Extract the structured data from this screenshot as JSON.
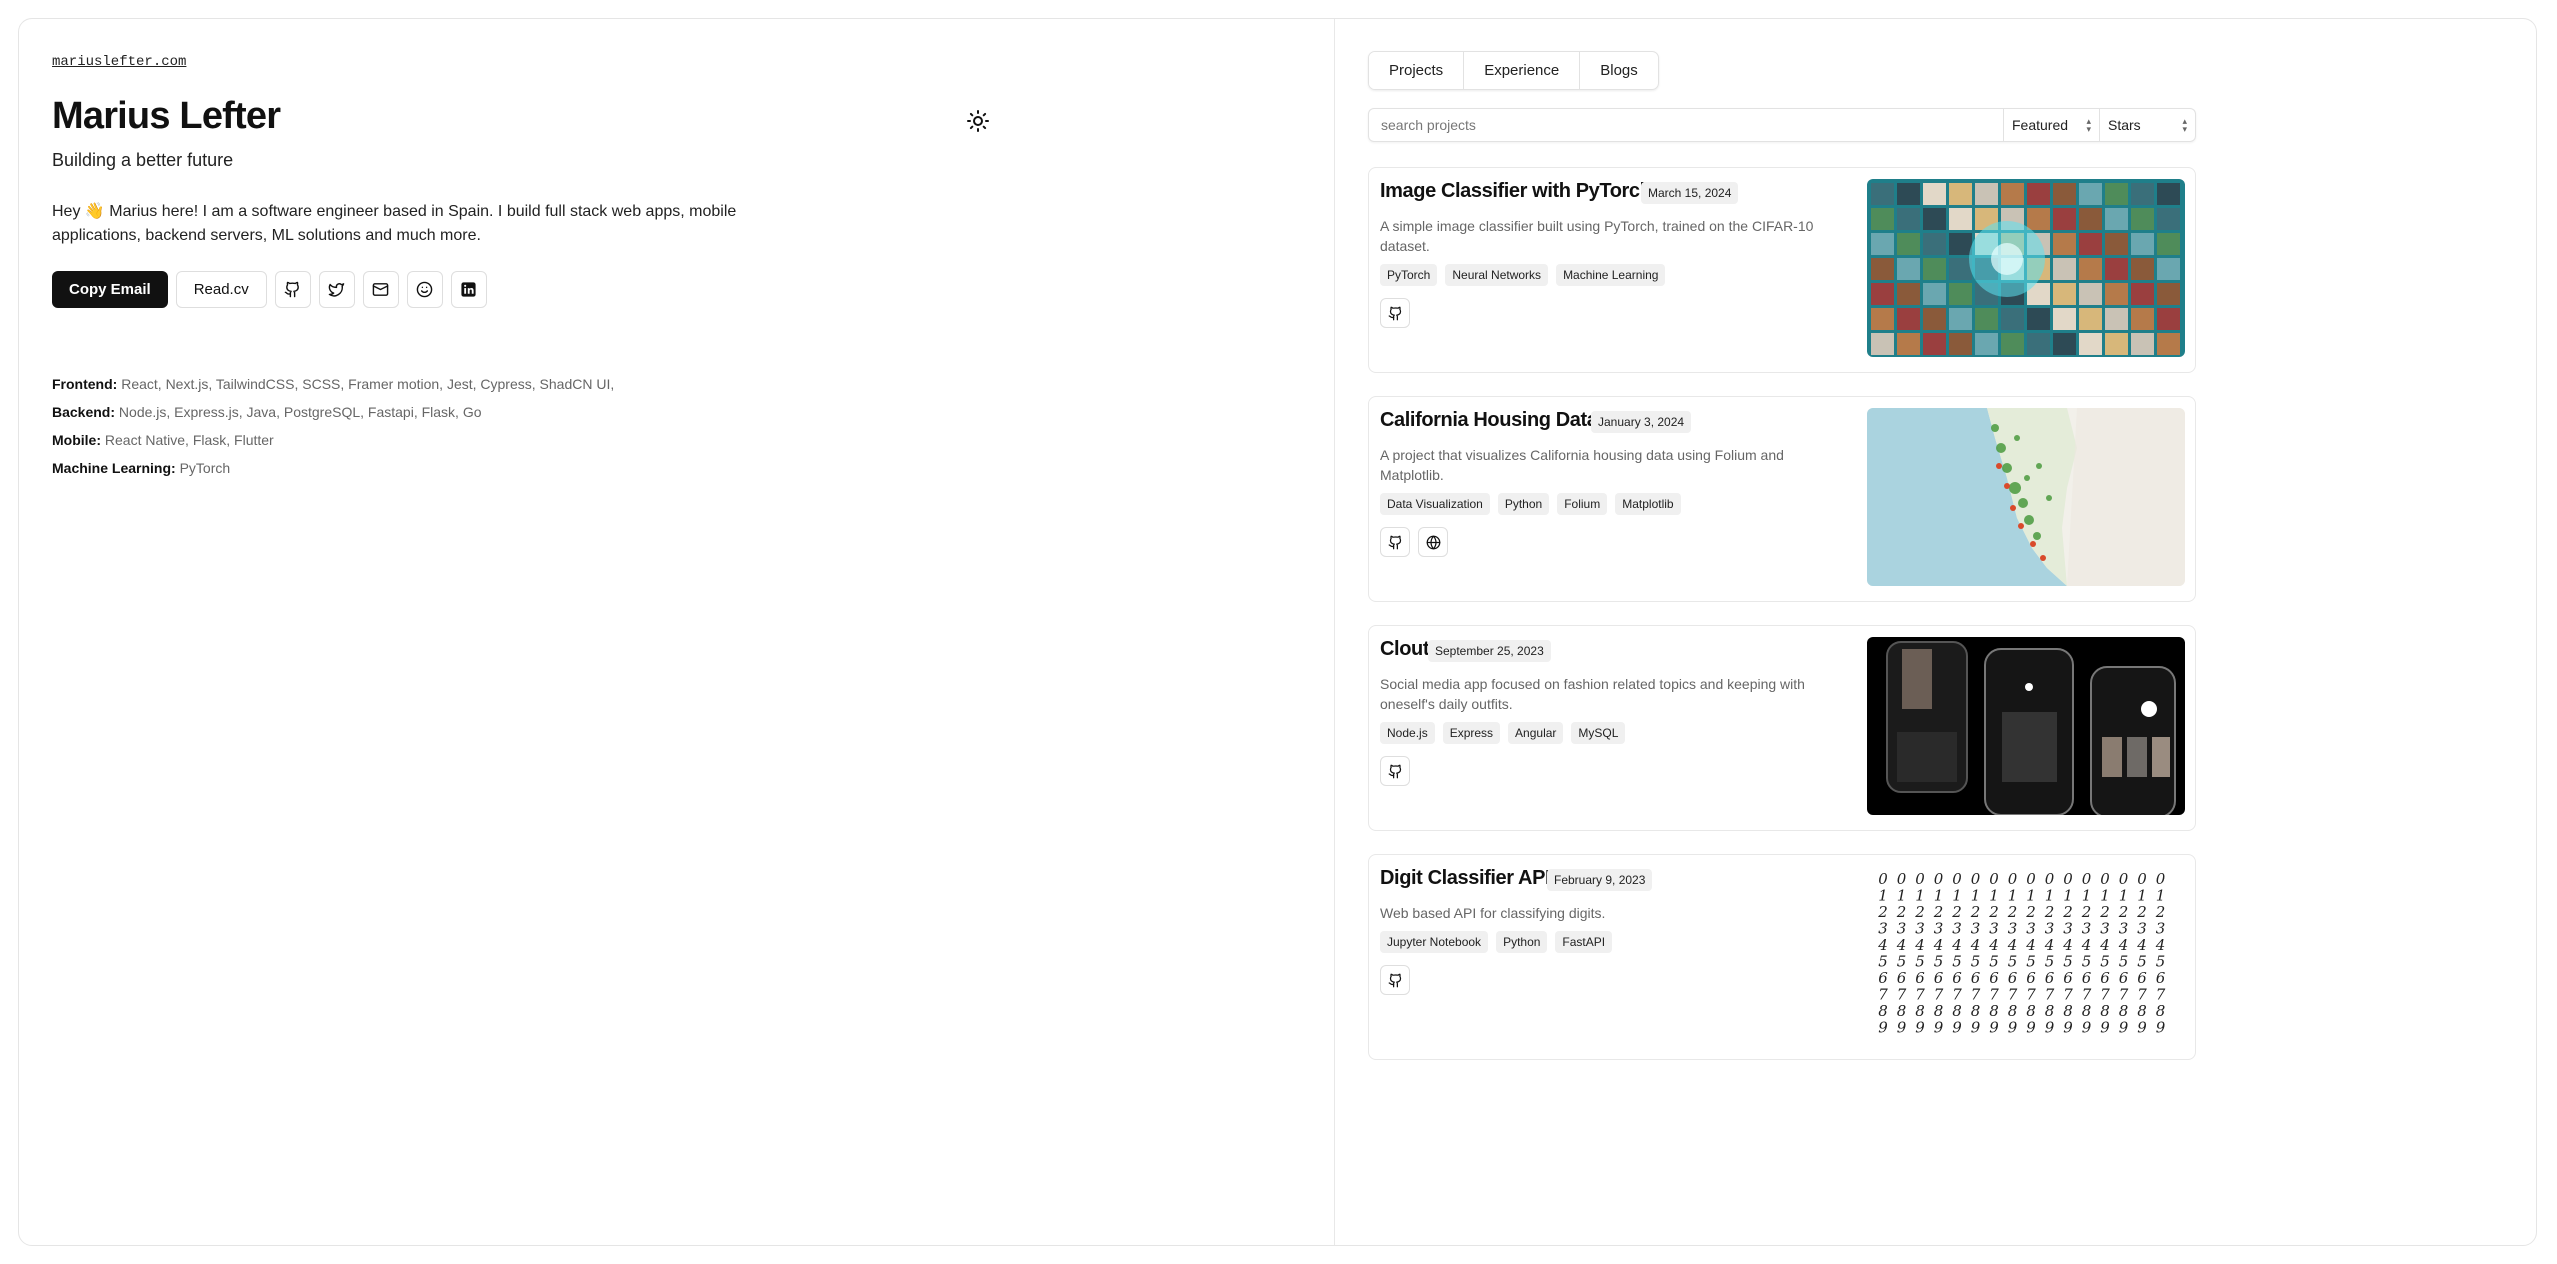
{
  "profile": {
    "domain": "mariuslefter.com",
    "name": "Marius Lefter",
    "tagline": "Building a better future",
    "bio": "Hey 👋 Marius here! I am a software engineer based in Spain. I build full stack web apps, mobile applications, backend servers, ML solutions and much more.",
    "copy_email_label": "Copy Email",
    "readcv_label": "Read.cv",
    "social_icons": [
      "github-icon",
      "twitter-icon",
      "mail-icon",
      "smile-icon",
      "linkedin-icon"
    ]
  },
  "skills": [
    {
      "label": "Frontend:",
      "value": "React, Next.js, TailwindCSS, SCSS, Framer motion, Jest, Cypress, ShadCN UI,"
    },
    {
      "label": "Backend:",
      "value": "Node.js, Express.js, Java, PostgreSQL, Fastapi, Flask, Go"
    },
    {
      "label": "Mobile:",
      "value": "React Native, Flask, Flutter"
    },
    {
      "label": "Machine Learning:",
      "value": "PyTorch"
    }
  ],
  "tabs": [
    "Projects",
    "Experience",
    "Blogs"
  ],
  "search": {
    "placeholder": "search projects",
    "filter_value": "Featured",
    "sort_value": "Stars"
  },
  "projects": [
    {
      "title": "Image Classifier with PyTorch",
      "date": "March 15, 2024",
      "description": "A simple image classifier built using PyTorch, trained on the CIFAR-10 dataset.",
      "tags": [
        "PyTorch",
        "Neural Networks",
        "Machine Learning"
      ],
      "links": [
        "github-icon"
      ]
    },
    {
      "title": "California Housing Data",
      "date": "January 3, 2024",
      "description": "A project that visualizes California housing data using Folium and Matplotlib.",
      "tags": [
        "Data Visualization",
        "Python",
        "Folium",
        "Matplotlib"
      ],
      "links": [
        "github-icon",
        "globe-icon"
      ]
    },
    {
      "title": "Clout",
      "date": "September 25, 2023",
      "description": "Social media app focused on fashion related topics and keeping with oneself's daily outfits.",
      "tags": [
        "Node.js",
        "Express",
        "Angular",
        "MySQL"
      ],
      "links": [
        "github-icon"
      ]
    },
    {
      "title": "Digit Classifier API",
      "date": "February 9, 2023",
      "description": "Web based API for classifying digits.",
      "tags": [
        "Jupyter Notebook",
        "Python",
        "FastAPI"
      ],
      "links": [
        "github-icon"
      ]
    }
  ]
}
